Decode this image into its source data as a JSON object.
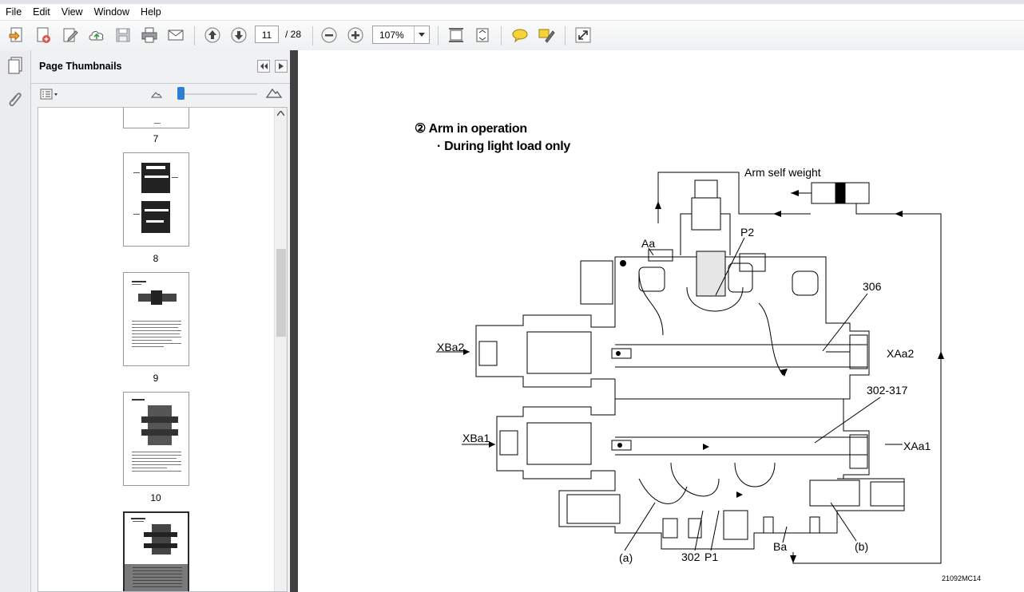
{
  "menu": [
    "File",
    "Edit",
    "View",
    "Window",
    "Help"
  ],
  "toolbar": {
    "page_current": "11",
    "page_total": "/ 28",
    "zoom": "107%"
  },
  "panel": {
    "title": "Page Thumbnails",
    "thumbnails": [
      {
        "label": "7"
      },
      {
        "label": "8"
      },
      {
        "label": "9"
      },
      {
        "label": "10"
      }
    ]
  },
  "document": {
    "heading_marker": "②",
    "heading": "Arm in operation",
    "subheading": "· During light load only",
    "labels": {
      "arm_self_weight": "Arm self weight",
      "aa": "Aa",
      "p2": "P2",
      "n306": "306",
      "xba2": "XBa2",
      "xaa2": "XAa2",
      "n302_317": "302-317",
      "xba1": "XBa1",
      "xaa1": "XAa1",
      "a": "(a)",
      "n302": "302",
      "p1": "P1",
      "ba": "Ba",
      "b": "(b)",
      "code": "21092MC14"
    }
  }
}
